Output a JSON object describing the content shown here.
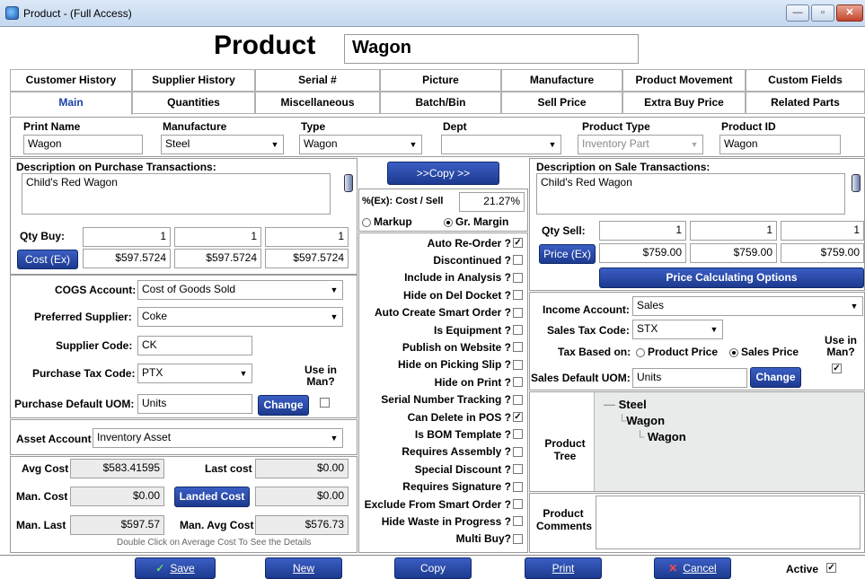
{
  "window": {
    "title": "Product - (Full Access)",
    "min": "—",
    "max": "▫",
    "close": "✕"
  },
  "header": {
    "title": "Product",
    "product_name": "Wagon"
  },
  "tabs_row1": [
    {
      "label": "Customer History"
    },
    {
      "label": "Supplier History"
    },
    {
      "label": "Serial #"
    },
    {
      "label": "Picture"
    },
    {
      "label": "Manufacture"
    },
    {
      "label": "Product Movement"
    },
    {
      "label": "Custom Fields"
    }
  ],
  "tabs_row2": [
    {
      "label": "Main",
      "active": true
    },
    {
      "label": "Quantities"
    },
    {
      "label": "Miscellaneous"
    },
    {
      "label": "Batch/Bin"
    },
    {
      "label": "Sell Price"
    },
    {
      "label": "Extra Buy Price"
    },
    {
      "label": "Related Parts"
    }
  ],
  "top_fields": {
    "print_name_label": "Print Name",
    "print_name": "Wagon",
    "manufacture_label": "Manufacture",
    "manufacture": "Steel",
    "type_label": "Type",
    "type": "Wagon",
    "dept_label": "Dept",
    "dept": "",
    "product_type_label": "Product Type",
    "product_type": "Inventory Part",
    "product_id_label": "Product ID",
    "product_id": "Wagon"
  },
  "purchase": {
    "desc_label": "Description on Purchase Transactions:",
    "desc": "Child's Red Wagon",
    "qty_buy_label": "Qty Buy:",
    "qty": [
      "1",
      "1",
      "1"
    ],
    "cost_button": "Cost (Ex)",
    "cost": [
      "$597.5724",
      "$597.5724",
      "$597.5724"
    ],
    "cogs_label": "COGS Account:",
    "cogs": "Cost of Goods Sold",
    "supplier_label": "Preferred Supplier:",
    "supplier": "Coke",
    "supplier_code_label": "Supplier Code:",
    "supplier_code": "CK",
    "tax_label": "Purchase Tax Code:",
    "tax": "PTX",
    "use_in_man_label": "Use in Man?",
    "uom_label": "Purchase Default UOM:",
    "uom": "Units",
    "change_button": "Change",
    "asset_label": "Asset Account",
    "asset": "Inventory Asset",
    "avg_cost_label": "Avg Cost",
    "avg_cost": "$583.41595",
    "last_cost_label": "Last cost",
    "last_cost": "$0.00",
    "man_cost_label": "Man. Cost",
    "man_cost": "$0.00",
    "landed_cost_button": "Landed Cost",
    "landed_cost": "$0.00",
    "man_last_label": "Man. Last",
    "man_last": "$597.57",
    "man_avg_label": "Man. Avg Cost",
    "man_avg": "$576.73",
    "hint": "Double Click on Average Cost To See the Details"
  },
  "middle": {
    "copy_button": ">>Copy >>",
    "cost_sell_label": "%(Ex): Cost / Sell",
    "cost_sell_value": "21.27%",
    "markup_label": "Markup",
    "margin_label": "Gr. Margin",
    "checks": [
      {
        "label": "Auto Re-Order ?",
        "checked": true
      },
      {
        "label": "Discontinued ?",
        "checked": false
      },
      {
        "label": "Include in Analysis ?",
        "checked": false
      },
      {
        "label": "Hide on Del Docket ?",
        "checked": false
      },
      {
        "label": "Auto Create Smart Order ?",
        "checked": false
      },
      {
        "label": "Is Equipment ?",
        "checked": false
      },
      {
        "label": "Publish on Website ?",
        "checked": false
      },
      {
        "label": "Hide on Picking Slip ?",
        "checked": false
      },
      {
        "label": "Hide on Print ?",
        "checked": false
      },
      {
        "label": "Serial Number Tracking ?",
        "checked": false
      },
      {
        "label": "Can Delete in POS ?",
        "checked": true
      },
      {
        "label": "Is BOM Template ?",
        "checked": false
      },
      {
        "label": "Requires Assembly ?",
        "checked": false
      },
      {
        "label": "Special Discount ?",
        "checked": false
      },
      {
        "label": "Requires Signature ?",
        "checked": false
      },
      {
        "label": "Exclude From Smart Order ?",
        "checked": false
      },
      {
        "label": "Hide Waste in Progress ?",
        "checked": false
      },
      {
        "label": "Multi Buy?",
        "checked": false
      }
    ]
  },
  "sale": {
    "desc_label": "Description on Sale Transactions:",
    "desc": "Child's Red Wagon",
    "qty_sell_label": "Qty Sell:",
    "qty": [
      "1",
      "1",
      "1"
    ],
    "price_button": "Price (Ex)",
    "price": [
      "$759.00",
      "$759.00",
      "$759.00"
    ],
    "options_button": "Price Calculating Options",
    "income_label": "Income Account:",
    "income": "Sales",
    "tax_label": "Sales Tax Code:",
    "tax": "STX",
    "tax_based_label": "Tax Based on:",
    "product_price_label": "Product Price",
    "sales_price_label": "Sales Price",
    "use_in_man_label": "Use in Man?",
    "uom_label": "Sales Default UOM:",
    "uom": "Units",
    "change_button": "Change",
    "tree_label": "Product Tree",
    "tree": [
      "Steel",
      "Wagon",
      "Wagon"
    ],
    "comments_label": "Product Comments",
    "comments": ""
  },
  "footer": {
    "save": "Save",
    "new": "New",
    "copy": "Copy",
    "print": "Print",
    "cancel": "Cancel",
    "active_label": "Active"
  }
}
